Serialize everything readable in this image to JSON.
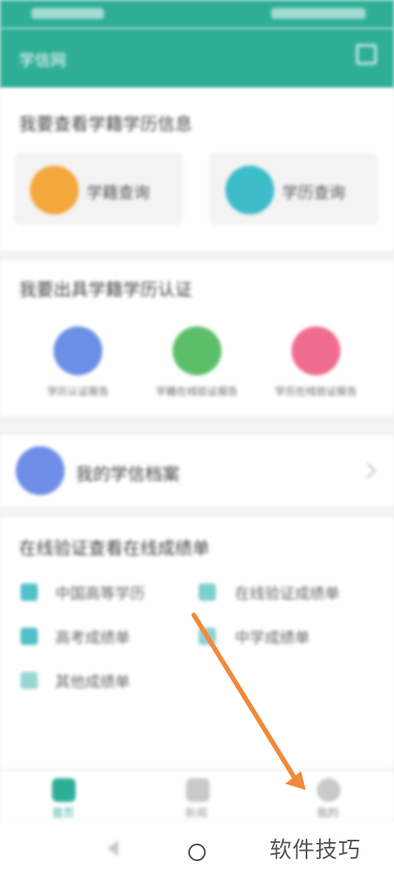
{
  "status_bar": {},
  "app_bar": {
    "title": "学信网"
  },
  "section_degree": {
    "title": "我要查看学籍学历信息",
    "tiles": [
      {
        "label": "学籍查询",
        "icon": "student-record-icon",
        "color": "#f2a83a"
      },
      {
        "label": "学历查询",
        "icon": "degree-record-icon",
        "color": "#3fbcc9"
      }
    ]
  },
  "section_report": {
    "title": "我要出具学籍学历认证",
    "items": [
      {
        "label": "学历认证报告",
        "icon": "report-icon",
        "color": "#6c8fe6"
      },
      {
        "label": "学籍在线验证报告",
        "icon": "verify-icon",
        "color": "#5bbf6a"
      },
      {
        "label": "学历在线验证报告",
        "icon": "online-report-icon",
        "color": "#ef6d8e"
      }
    ]
  },
  "section_account": {
    "label": "我的学信档案",
    "icon": "archive-icon",
    "color": "#6f8ee8"
  },
  "section_other": {
    "title": "在线验证查看在线成绩单",
    "items": [
      {
        "label": "中国高等学历",
        "icon": "pencil-icon",
        "color": "#52bfc9"
      },
      {
        "label": "在线验证成绩单",
        "icon": "card-icon",
        "color": "#7ecfcf"
      },
      {
        "label": "高考成绩单",
        "icon": "diamond-icon",
        "color": "#52bfc9"
      },
      {
        "label": "中学成绩单",
        "icon": "grade-icon",
        "color": "#8fd0d0"
      },
      {
        "label": "其他成绩单",
        "icon": "doc-icon",
        "color": "#9ad5d5"
      }
    ]
  },
  "bottom_nav": {
    "items": [
      {
        "label": "首页",
        "icon": "home-icon",
        "color": "#2fae97"
      },
      {
        "label": "新闻",
        "icon": "news-icon",
        "color": "#c9c9c9"
      },
      {
        "label": "我的",
        "icon": "profile-icon",
        "color": "#c9c9c9"
      }
    ]
  },
  "watermark": {
    "text": "软件技巧"
  },
  "annotation": {
    "color": "#f08a3a"
  }
}
